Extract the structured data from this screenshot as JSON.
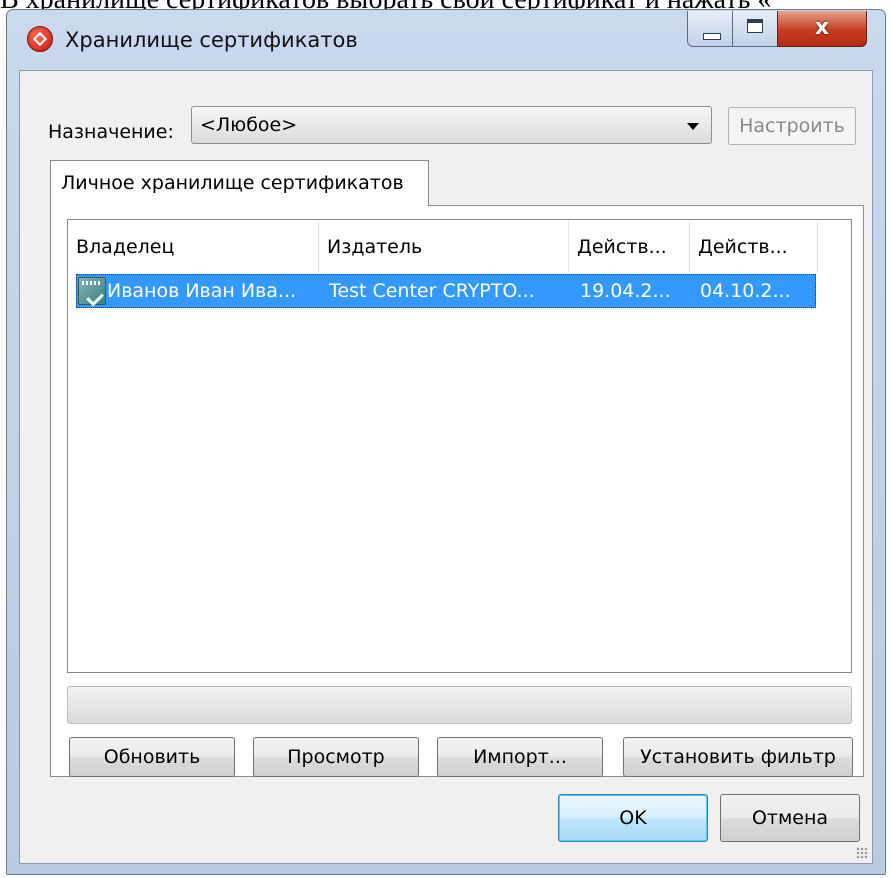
{
  "caption": "В хранилище сертификатов выбрать свой сертификат и нажать «",
  "window": {
    "title": "Хранилище сертификатов",
    "close_glyph": "x",
    "icons": {
      "app": "crypto-app-icon",
      "minimize": "minimize-icon",
      "maximize": "maximize-icon",
      "close": "close-icon"
    }
  },
  "purpose": {
    "label": "Назначение:",
    "value": "<Любое>",
    "configure_label": "Настроить"
  },
  "tab": {
    "label": "Личное хранилище сертификатов"
  },
  "table": {
    "columns": [
      "Владелец",
      "Издатель",
      "Действ...",
      "Действ..."
    ],
    "rows": [
      {
        "icon": "certificate-icon",
        "cells": [
          "Иванов Иван Ива...",
          "Test Center CRYPTO...",
          "19.04.2...",
          "04.10.2..."
        ],
        "selected": true
      }
    ]
  },
  "buttons": {
    "refresh": "Обновить",
    "view": "Просмотр",
    "import": "Импорт...",
    "filter": "Установить фильтр",
    "ok": "OK",
    "cancel": "Отмена"
  },
  "colors": {
    "selection": "#3399ff",
    "close_button": "#c63d22",
    "frame": "#c9d9ee"
  }
}
